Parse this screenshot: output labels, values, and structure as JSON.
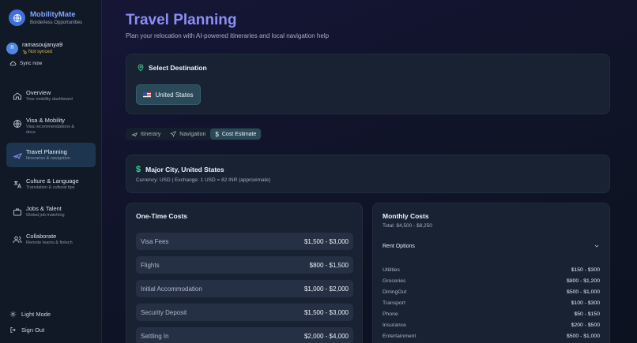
{
  "brand": {
    "name": "MobilityMate",
    "tagline": "Borderless Opportunities"
  },
  "user": {
    "initial": "R",
    "name": "ramasoujanya9",
    "status": "Not synced",
    "sync_label": "Sync now"
  },
  "nav": [
    {
      "label": "Overview",
      "sub": "Your mobility dashboard",
      "icon": "home-icon"
    },
    {
      "label": "Visa & Mobility",
      "sub": "Visa recommendations & docs",
      "icon": "globe-icon"
    },
    {
      "label": "Travel Planning",
      "sub": "Itineraries & navigation",
      "icon": "plane-icon",
      "active": true
    },
    {
      "label": "Culture & Language",
      "sub": "Translation & cultural tips",
      "icon": "translate-icon"
    },
    {
      "label": "Jobs & Talent",
      "sub": "Global job matching",
      "icon": "briefcase-icon"
    },
    {
      "label": "Collaborate",
      "sub": "Remote teams & fintech",
      "icon": "users-icon"
    }
  ],
  "footer": {
    "light_mode": "Light Mode",
    "sign_out": "Sign Out"
  },
  "page": {
    "title": "Travel Planning",
    "subtitle": "Plan your relocation with AI-powered itineraries and local navigation help"
  },
  "destination": {
    "heading": "Select Destination",
    "selected": "United States"
  },
  "tabs": [
    {
      "label": "Itinerary",
      "icon": "plane-icon"
    },
    {
      "label": "Navigation",
      "icon": "navigation-icon"
    },
    {
      "label": "Cost Estimate",
      "icon": "dollar-icon",
      "active": true
    }
  ],
  "city": {
    "title": "Major City, United States",
    "currency": "Currency: USD | Exchange: 1 USD = 82 INR (approximate)"
  },
  "one_time": {
    "title": "One-Time Costs",
    "rows": [
      {
        "label": "Visa Fees",
        "value": "$1,500 - $3,000"
      },
      {
        "label": "Flights",
        "value": "$800 - $1,500"
      },
      {
        "label": "Initial Accommodation",
        "value": "$1,000 - $2,000"
      },
      {
        "label": "Security Deposit",
        "value": "$1,500 - $3,000"
      },
      {
        "label": "Settling In",
        "value": "$2,000 - $4,000"
      }
    ]
  },
  "monthly": {
    "title": "Monthly Costs",
    "total": "Total: $4,500 - $8,250",
    "rent_label": "Rent Options",
    "rows": [
      {
        "label": "Utilities",
        "value": "$150 - $300"
      },
      {
        "label": "Groceries",
        "value": "$800 - $1,200"
      },
      {
        "label": "DiningOut",
        "value": "$500 - $1,000"
      },
      {
        "label": "Transport",
        "value": "$100 - $300"
      },
      {
        "label": "Phone",
        "value": "$50 - $150"
      },
      {
        "label": "Insurance",
        "value": "$200 - $500"
      },
      {
        "label": "Entertainment",
        "value": "$500 - $1,000"
      }
    ]
  },
  "colors": {
    "accent": "#8c8ff5",
    "teal": "#2a4a5a",
    "green": "#3ecf8e",
    "warning": "#d8b347"
  }
}
